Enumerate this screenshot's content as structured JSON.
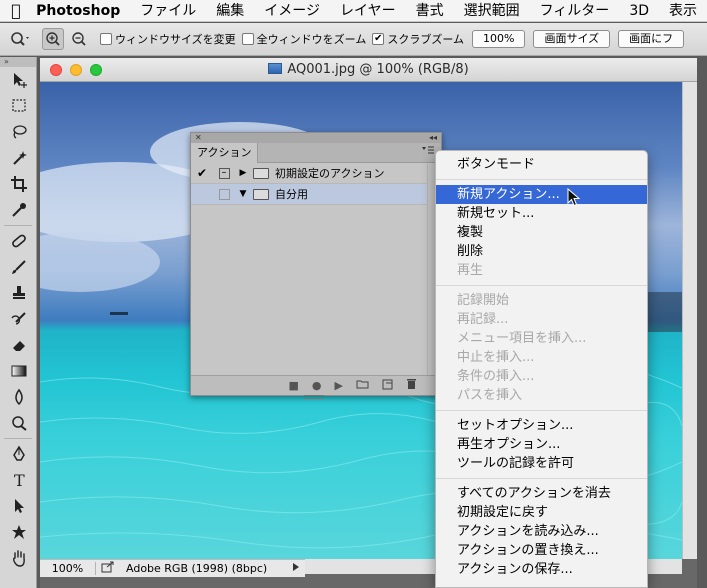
{
  "menubar": {
    "app": "Photoshop",
    "items": [
      "ファイル",
      "編集",
      "イメージ",
      "レイヤー",
      "書式",
      "選択範囲",
      "フィルター",
      "3D",
      "表示"
    ]
  },
  "options": {
    "resize_windows": "ウィンドウサイズを変更",
    "zoom_all": "全ウィンドウをズーム",
    "scrubby_zoom": "スクラブズーム",
    "btn_100": "100%",
    "btn_fit": "画面サイズ",
    "btn_fill": "画面にフ"
  },
  "document": {
    "title": "AQ001.jpg @ 100% (RGB/8)",
    "zoom": "100%",
    "profile": "Adobe RGB (1998) (8bpc)"
  },
  "actions_panel": {
    "tab": "アクション",
    "rows": [
      {
        "name": "初期設定のアクション",
        "check": "✔",
        "disclosure": "▶"
      },
      {
        "name": "自分用",
        "check": "",
        "disclosure": "▼"
      }
    ]
  },
  "menu": {
    "items": [
      {
        "label": "ボタンモード",
        "state": "normal"
      },
      {
        "sep": true
      },
      {
        "label": "新規アクション...",
        "state": "highlighted"
      },
      {
        "label": "新規セット...",
        "state": "normal"
      },
      {
        "label": "複製",
        "state": "normal"
      },
      {
        "label": "削除",
        "state": "normal"
      },
      {
        "label": "再生",
        "state": "disabled"
      },
      {
        "sep": true
      },
      {
        "label": "記録開始",
        "state": "disabled"
      },
      {
        "label": "再記録...",
        "state": "disabled"
      },
      {
        "label": "メニュー項目を挿入...",
        "state": "disabled"
      },
      {
        "label": "中止を挿入...",
        "state": "disabled"
      },
      {
        "label": "条件の挿入...",
        "state": "disabled"
      },
      {
        "label": "パスを挿入",
        "state": "disabled"
      },
      {
        "sep": true
      },
      {
        "label": "セットオプション...",
        "state": "normal"
      },
      {
        "label": "再生オプション...",
        "state": "normal"
      },
      {
        "label": "ツールの記録を許可",
        "state": "normal"
      },
      {
        "sep": true
      },
      {
        "label": "すべてのアクションを消去",
        "state": "normal"
      },
      {
        "label": "初期設定に戻す",
        "state": "normal"
      },
      {
        "label": "アクションを読み込み...",
        "state": "normal"
      },
      {
        "label": "アクションの置き換え...",
        "state": "normal"
      },
      {
        "label": "アクションの保存...",
        "state": "normal"
      }
    ]
  },
  "colors": {
    "menu_highlight": "#3567d6",
    "close": "#fd5f57",
    "minimize": "#febc2e",
    "zoom": "#27c840"
  }
}
